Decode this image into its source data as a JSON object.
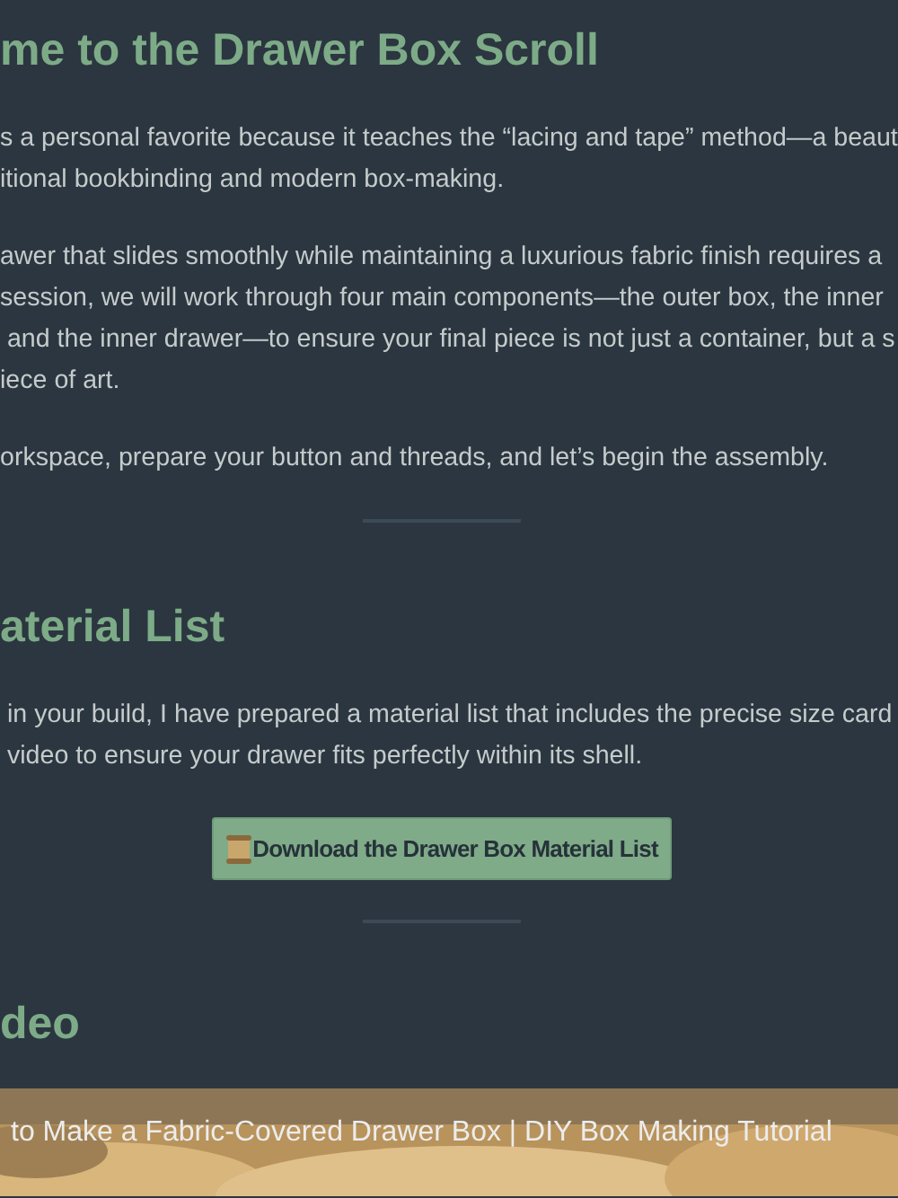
{
  "sections": [
    {
      "heading": "me to the Drawer Box Scroll",
      "paragraphs": [
        [
          "s a personal favorite because it teaches the “lacing and tape” method—a beaut",
          "itional bookbinding and modern box-making."
        ],
        [
          "awer that slides smoothly while maintaining a luxurious fabric finish requires a",
          "session, we will work through four main components—the outer box, the inner",
          " and the inner drawer—to ensure your final piece is not just a container, but a s",
          "iece of art."
        ],
        [
          "orkspace, prepare your button and threads, and let’s begin the assembly."
        ]
      ]
    },
    {
      "heading": "aterial List",
      "paragraphs": [
        [
          " in your build, I have prepared a material list that includes the precise size card",
          " video to ensure your drawer fits perfectly within its shell."
        ]
      ],
      "button": "Download the Drawer Box Material List"
    },
    {
      "heading": "deo",
      "video": {
        "kind": "picture",
        "title": "to Make a Fabric-Covered Drawer Box | DIY Box Making Tutorial"
      }
    }
  ]
}
